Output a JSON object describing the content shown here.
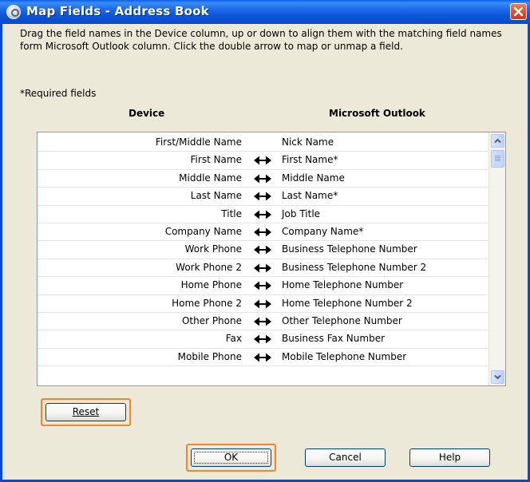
{
  "window": {
    "title": "Map Fields - Address Book",
    "icon": "app-icon",
    "close_icon": "close-icon"
  },
  "instructions": "Drag the field names in the Device column, up or down to align them with the matching field names form Microsoft Outlook column. Click the double arrow to map or unmap a field.",
  "required_note": "*Required fields",
  "columns": {
    "device": "Device",
    "outlook": "Microsoft Outlook"
  },
  "rows": [
    {
      "device": "First/Middle Name",
      "outlook": "Nick Name",
      "mapped": false
    },
    {
      "device": "First Name",
      "outlook": "First Name*",
      "mapped": true
    },
    {
      "device": "Middle Name",
      "outlook": "Middle Name",
      "mapped": true
    },
    {
      "device": "Last Name",
      "outlook": "Last Name*",
      "mapped": true
    },
    {
      "device": "Title",
      "outlook": "Job Title",
      "mapped": true
    },
    {
      "device": "Company Name",
      "outlook": "Company Name*",
      "mapped": true
    },
    {
      "device": "Work Phone",
      "outlook": "Business Telephone Number",
      "mapped": true
    },
    {
      "device": "Work Phone 2",
      "outlook": "Business Telephone Number 2",
      "mapped": true
    },
    {
      "device": "Home Phone",
      "outlook": "Home Telephone Number",
      "mapped": true
    },
    {
      "device": "Home Phone 2",
      "outlook": "Home Telephone Number 2",
      "mapped": true
    },
    {
      "device": "Other Phone",
      "outlook": "Other Telephone Number",
      "mapped": true
    },
    {
      "device": "Fax",
      "outlook": "Business Fax Number",
      "mapped": true
    },
    {
      "device": "Mobile Phone",
      "outlook": "Mobile Telephone Number",
      "mapped": true
    }
  ],
  "buttons": {
    "reset": "Reset",
    "ok": "OK",
    "cancel": "Cancel",
    "help": "Help"
  },
  "colors": {
    "titlebar": "#0A5FE8",
    "dialog_bg": "#ECE9D8",
    "highlight": "#F2852E"
  }
}
